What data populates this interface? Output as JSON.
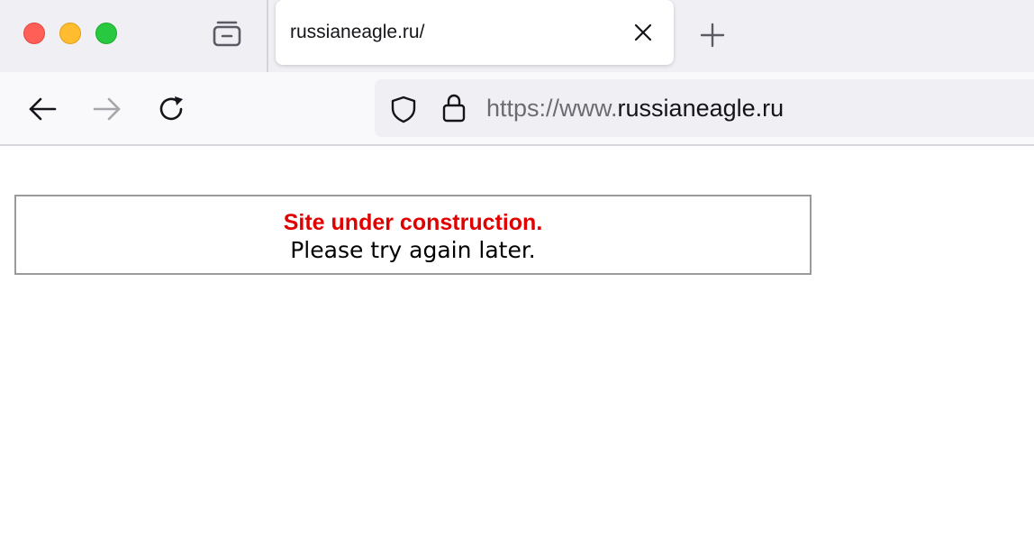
{
  "browser": {
    "tab": {
      "title": "russianeagle.ru/"
    },
    "url": {
      "protocol_prefix": "https://www.",
      "domain": "russianeagle.ru"
    },
    "icons": {
      "window_close": "traffic-light-close",
      "window_minimize": "traffic-light-minimize",
      "window_maximize": "traffic-light-maximize",
      "tab_overview": "tab-tray-icon",
      "tab_close": "close-icon",
      "new_tab": "plus-icon",
      "back": "arrow-left-icon",
      "forward": "arrow-right-icon",
      "reload": "reload-icon",
      "tracking": "shield-icon",
      "security": "lock-icon"
    },
    "colors": {
      "close": "#ff5f57",
      "minimize": "#febc2e",
      "maximize": "#28c840"
    }
  },
  "page": {
    "notice_title": "Site under construction.",
    "notice_body": "Please try again later.",
    "colors": {
      "title": "#e00000",
      "border": "#9a9a9a"
    }
  }
}
